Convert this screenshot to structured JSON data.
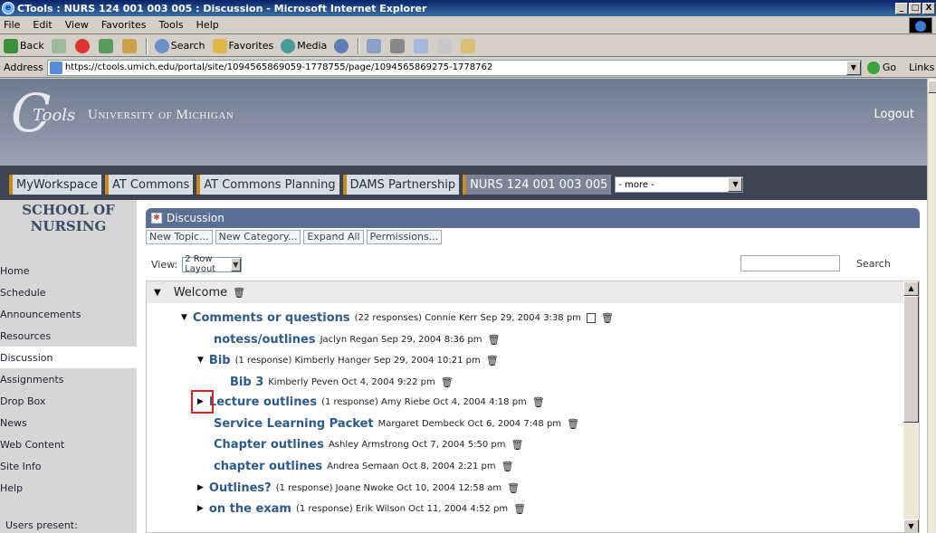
{
  "window": {
    "title": "CTools : NURS 124 001 003 005 : Discussion - Microsoft Internet Explorer",
    "controls": [
      "_",
      "□",
      "X"
    ]
  },
  "menu": [
    "File",
    "Edit",
    "View",
    "Favorites",
    "Tools",
    "Help"
  ],
  "toolbar": {
    "back": "Back",
    "search": "Search",
    "favorites": "Favorites",
    "media": "Media"
  },
  "address": {
    "label": "Address",
    "url": "https://ctools.umich.edu/portal/site/1094565869059-1778755/page/1094565869275-1778762",
    "go": "Go",
    "links": "Links"
  },
  "banner": {
    "logo_letter": "C",
    "logo_word": "Tools",
    "university": "University of Michigan",
    "logout": "Logout"
  },
  "tabs": [
    {
      "label": "MyWorkspace"
    },
    {
      "label": "AT Commons"
    },
    {
      "label": "AT Commons Planning"
    },
    {
      "label": "DAMS Partnership"
    },
    {
      "label": "NURS 124 001 003 005"
    }
  ],
  "more_select": "- more -",
  "sidebar": {
    "school_line1": "SCHOOL OF",
    "school_line2": "NURSING",
    "items": [
      {
        "label": "Home"
      },
      {
        "label": "Schedule"
      },
      {
        "label": "Announcements"
      },
      {
        "label": "Resources"
      },
      {
        "label": "Discussion"
      },
      {
        "label": "Assignments"
      },
      {
        "label": "Drop Box"
      },
      {
        "label": "News"
      },
      {
        "label": "Web Content"
      },
      {
        "label": "Site Info"
      },
      {
        "label": "Help"
      }
    ],
    "users_present": "Users present:"
  },
  "portlet": {
    "title": "Discussion",
    "actions": [
      "New Topic...",
      "New Category...",
      "Expand All",
      "Permissions..."
    ],
    "view_label": "View:",
    "view_value": "2 Row Layout",
    "search_label": "Search"
  },
  "thread": {
    "category": "Welcome",
    "rows": [
      {
        "title": "Comments or questions",
        "meta": "(22 responses) Connie Kerr Sep 29, 2004 3:38 pm"
      },
      {
        "title": "notess/outlines",
        "meta": "Jaclyn Regan Sep 29, 2004 8:36 pm"
      },
      {
        "title": "Bib",
        "meta": "(1 response) Kimberly Hanger Sep 29, 2004 10:21 pm"
      },
      {
        "title": "Bib 3",
        "meta": "Kimberly Peven Oct 4, 2004 9:22 pm"
      },
      {
        "title": "Lecture outlines",
        "meta": "(1 response) Amy Riebe Oct 4, 2004 4:18 pm"
      },
      {
        "title": "Service Learning Packet",
        "meta": "Margaret Dembeck Oct 6, 2004 7:48 pm"
      },
      {
        "title": "Chapter outlines",
        "meta": "Ashley Armstrong Oct 7, 2004 5:50 pm"
      },
      {
        "title": "chapter outlines",
        "meta": "Andrea Semaan Oct 8, 2004 2:21 pm"
      },
      {
        "title": "Outlines?",
        "meta": "(1 response) Joane Nwoke Oct 10, 2004 12:58 am"
      },
      {
        "title": "on the exam",
        "meta": "(1 response) Erik Wilson Oct 11, 2004 4:52 pm"
      }
    ]
  }
}
